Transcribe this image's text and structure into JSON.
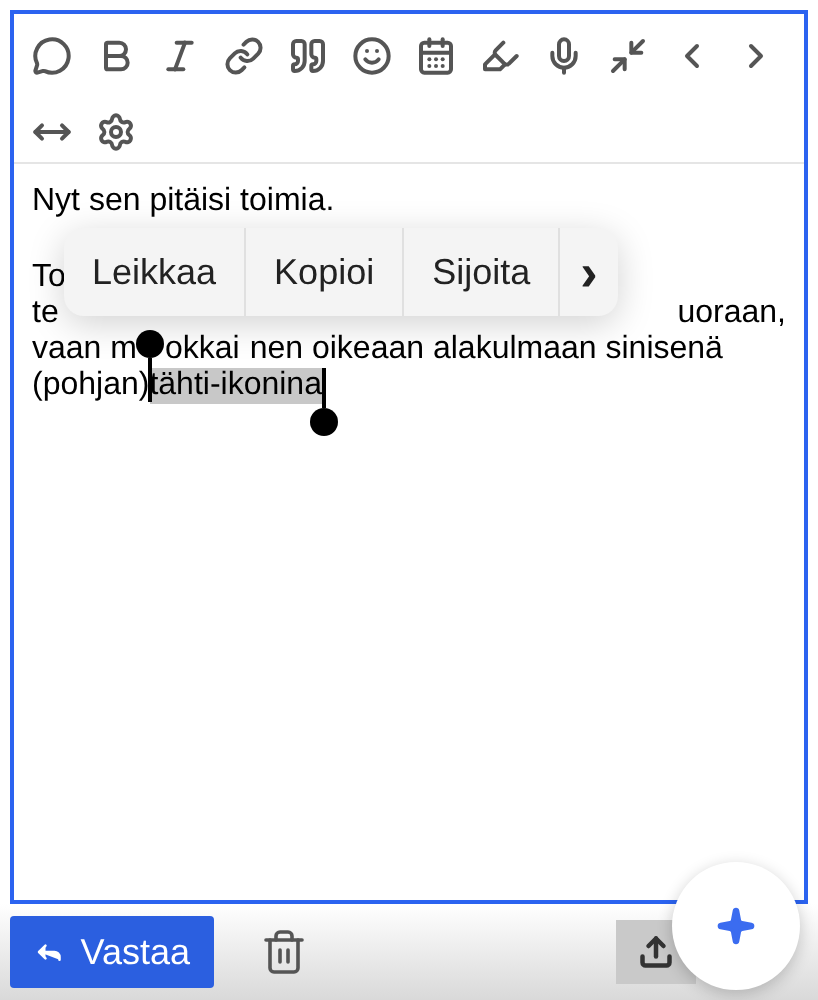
{
  "editor": {
    "paragraphs": [
      {
        "lines": [
          {
            "segments": [
              {
                "text": "Nyt sen pitäisi toimia.",
                "selected": false
              }
            ]
          }
        ]
      },
      {
        "lines": [
          {
            "segments": [
              {
                "text": "To",
                "selected": false
              }
            ]
          },
          {
            "segments": [
              {
                "text": "te",
                "selected": false
              },
              {
                "text": "uoraan,",
                "selected": false
              }
            ]
          },
          {
            "segments": [
              {
                "text": "vaan m",
                "selected": false
              },
              {
                "text": "okkai",
                "selected": false
              },
              {
                "text": "nen oikeaan alakulmaan sinisenä",
                "selected": false
              }
            ]
          },
          {
            "segments": [
              {
                "text": "(pohjan)",
                "selected": false
              },
              {
                "text": "tähti-ikonina",
                "selected": true
              }
            ]
          }
        ]
      }
    ]
  },
  "context_menu": {
    "items": [
      "Leikkaa",
      "Kopioi",
      "Sijoita"
    ],
    "more": "›"
  },
  "reply_button": {
    "label": "Vastaa"
  }
}
